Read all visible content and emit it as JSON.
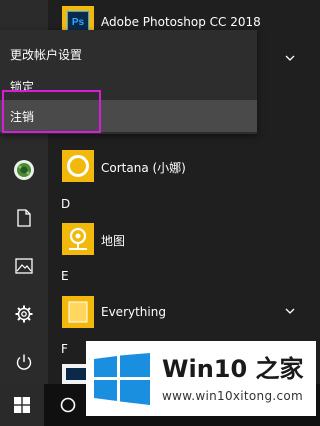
{
  "account_menu": {
    "items": [
      {
        "label": "更改帐户设置"
      },
      {
        "label": "锁定"
      },
      {
        "label": "注销"
      }
    ]
  },
  "apps": {
    "photoshop": "Adobe Photoshop CC 2018",
    "photoshop_icon_text": "Ps",
    "cortana": "Cortana (小娜)",
    "maps": "地图",
    "everything": "Everything"
  },
  "letters": {
    "d": "D",
    "e": "E",
    "f": "F"
  },
  "watermark": {
    "title": "Win10 之家",
    "url": "www.win10xitong.com"
  },
  "colors": {
    "accent_yellow": "#f2b90c",
    "photoshop_blue": "#0b2a4a",
    "highlight_magenta": "#d41fd6",
    "win_blue": "#1a8fe0"
  }
}
